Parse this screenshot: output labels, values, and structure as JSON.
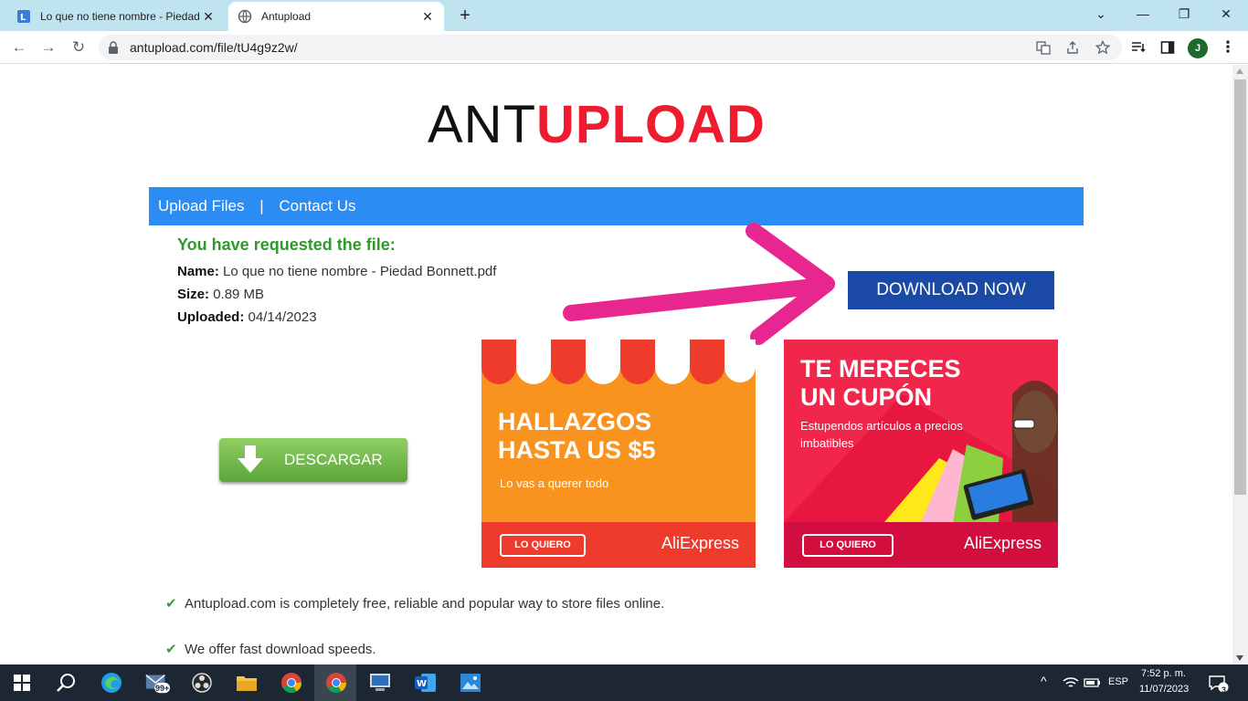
{
  "browser": {
    "tabs": [
      {
        "title": "Lo que no tiene nombre - Piedad",
        "active": false,
        "favicon": "book-icon"
      },
      {
        "title": "Antupload",
        "active": true,
        "favicon": "globe-icon"
      }
    ],
    "url": "antupload.com/file/tU4g9z2w/",
    "profile_initial": "J"
  },
  "site": {
    "logo_left": "ANT",
    "logo_right": "UPLOAD",
    "nav": {
      "upload": "Upload Files",
      "separator": "|",
      "contact": "Contact Us"
    },
    "requested_heading": "You have requested the file:",
    "file": {
      "name_label": "Name:",
      "name": "Lo que no tiene nombre - Piedad Bonnett.pdf",
      "size_label": "Size:",
      "size": "0.89 MB",
      "uploaded_label": "Uploaded:",
      "uploaded": "04/14/2023"
    },
    "download_now": "DOWNLOAD NOW",
    "descargar": "DESCARGAR",
    "features": [
      "Antupload.com is completely free, reliable and popular way to store files online.",
      "We offer fast download speeds."
    ]
  },
  "ads": [
    {
      "headline_1": "HALLAZGOS",
      "headline_2": "HASTA US $5",
      "sub": "Lo vas a querer todo",
      "button": "LO QUIERO",
      "brand": "AliExpress"
    },
    {
      "headline_1": "TE MERECES",
      "headline_2": "UN CUPÓN",
      "sub_1": "Estupendos artículos a precios",
      "sub_2": "imbatibles",
      "button": "LO QUIERO",
      "brand": "AliExpress"
    }
  ],
  "taskbar": {
    "mail_badge": "99+",
    "language": "ESP",
    "time": "7:52 p. m.",
    "date": "11/07/2023",
    "notifications": "3"
  },
  "colors": {
    "accent_blue": "#2b8cf4",
    "download_blue": "#1a4aa6",
    "logo_red": "#ee1c2e",
    "success_green": "#2e9a2a",
    "annotation_pink": "#e8268f"
  }
}
